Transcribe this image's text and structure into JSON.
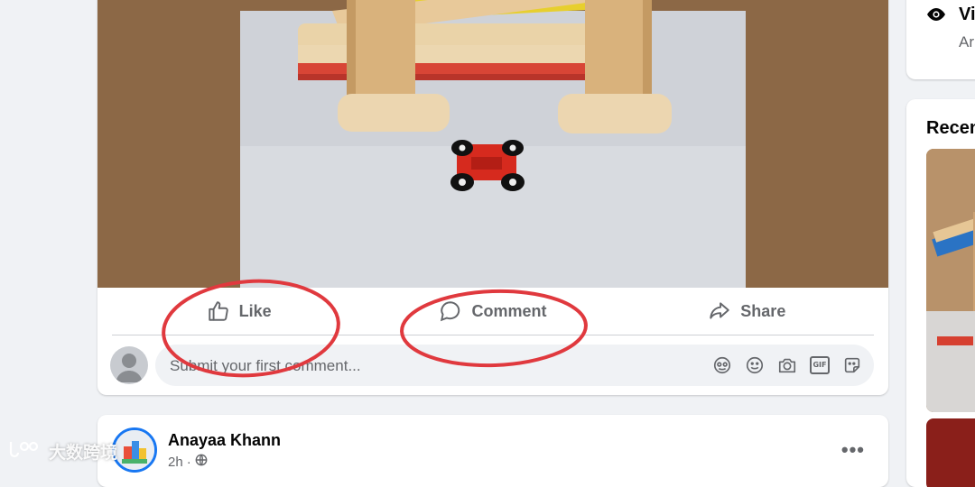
{
  "post": {
    "actions": {
      "like_label": "Like",
      "comment_label": "Comment",
      "share_label": "Share"
    },
    "comment_composer": {
      "placeholder": "Submit your first comment...",
      "tool_icons": [
        "avatar-sticker-icon",
        "emoji-icon",
        "camera-icon",
        "gif-icon",
        "sticker-icon"
      ],
      "gif_label": "GIF"
    }
  },
  "next_post": {
    "author_name": "Anayaa Khann",
    "time": "2h",
    "separator": "·",
    "privacy_icon": "globe-icon",
    "more_label": "•••"
  },
  "sidebar": {
    "top_card": {
      "heading_partial": "Vi",
      "subtext_partial": "Ar",
      "icon": "eye-icon"
    },
    "recent_card": {
      "title_partial": "Recen"
    }
  },
  "watermark": {
    "text": "大数跨境"
  },
  "colors": {
    "page_bg": "#f0f2f5",
    "card_bg": "#ffffff",
    "muted_text": "#65676b",
    "annotation_red": "#e0393e",
    "brand_blue": "#1877f2"
  }
}
